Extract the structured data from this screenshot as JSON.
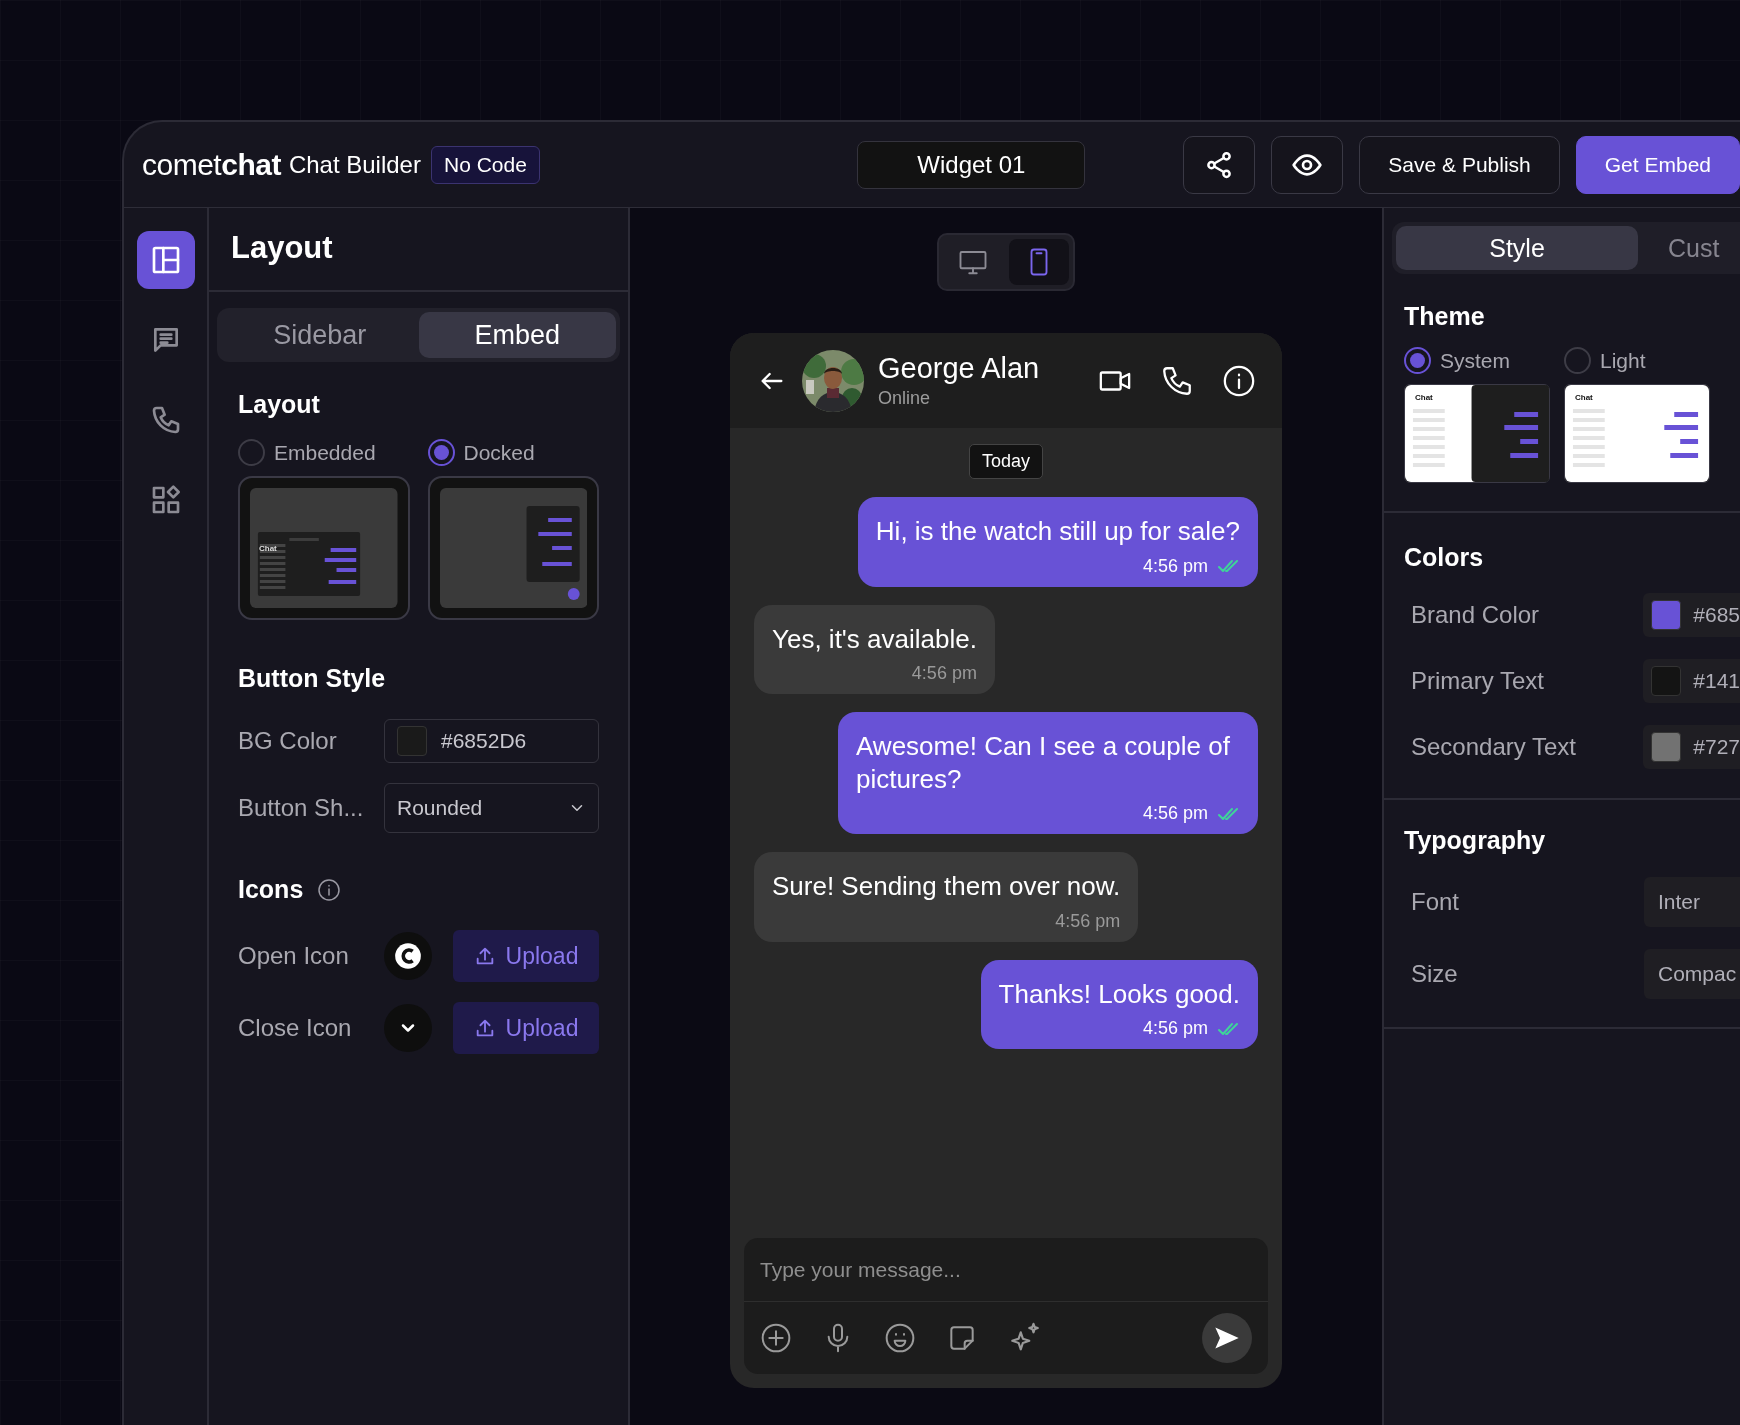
{
  "header": {
    "logo_light": "comet",
    "logo_bold": "chat",
    "product": "Chat Builder",
    "badge": "No Code",
    "widget_name": "Widget 01",
    "save_button": "Save & Publish",
    "embed_button": "Get Embed"
  },
  "rail": [
    {
      "kind": "layout",
      "selected": true
    },
    {
      "kind": "chat",
      "selected": false
    },
    {
      "kind": "call",
      "selected": false
    },
    {
      "kind": "widgets",
      "selected": false
    }
  ],
  "left_panel": {
    "title": "Layout",
    "tabs": [
      {
        "label": "Sidebar",
        "selected": false
      },
      {
        "label": "Embed",
        "selected": true
      }
    ],
    "layout_section": {
      "title": "Layout",
      "options": [
        {
          "label": "Embedded",
          "selected": false,
          "kind": "embedded",
          "preview_label": "Chat"
        },
        {
          "label": "Docked",
          "selected": true,
          "kind": "docked"
        }
      ]
    },
    "button_style": {
      "title": "Button Style",
      "bg_color": {
        "label": "BG Color",
        "value": "#6852D6",
        "color": "#1a1a1a"
      },
      "shape": {
        "label": "Button Sh...",
        "value": "Rounded"
      }
    },
    "icons": {
      "title": "Icons",
      "rows": [
        {
          "label": "Open Icon",
          "kind": "logo",
          "button": "Upload"
        },
        {
          "label": "Close Icon",
          "kind": "chevron",
          "button": "Upload"
        }
      ]
    }
  },
  "device_toggle": [
    {
      "kind": "desktop",
      "selected": false
    },
    {
      "kind": "mobile",
      "selected": true
    }
  ],
  "chat": {
    "name": "George Alan",
    "status": "Online",
    "date_chip": "Today",
    "messages": [
      {
        "text": "Hi, is the watch still up for sale?",
        "time": "4:56 pm",
        "outgoing": true,
        "read": true
      },
      {
        "text": "Yes, it's available.",
        "time": "4:56 pm",
        "outgoing": false,
        "read": false
      },
      {
        "text": "Awesome! Can I see a couple of pictures?",
        "time": "4:56 pm",
        "outgoing": true,
        "read": true
      },
      {
        "text": "Sure! Sending them over now.",
        "time": "4:56 pm",
        "outgoing": false,
        "read": false
      },
      {
        "text": "Thanks! Looks good.",
        "time": "4:56 pm",
        "outgoing": true,
        "read": true
      }
    ],
    "composer": {
      "placeholder": "Type your message..."
    }
  },
  "right_panel": {
    "tabs": [
      {
        "label": "Style",
        "selected": true
      },
      {
        "label": "Cust",
        "selected": false
      }
    ],
    "theme": {
      "title": "Theme",
      "options": [
        {
          "label": "System",
          "selected": true,
          "kind": "system",
          "preview_label": "Chat"
        },
        {
          "label": "Light",
          "selected": false,
          "kind": "light",
          "preview_label": "Chat"
        }
      ]
    },
    "colors": {
      "title": "Colors",
      "rows": [
        {
          "label": "Brand Color",
          "value": "#685",
          "color": "#6852d6"
        },
        {
          "label": "Primary Text",
          "value": "#141",
          "color": "#141414"
        },
        {
          "label": "Secondary Text",
          "value": "#727",
          "color": "#727272"
        }
      ]
    },
    "typography": {
      "title": "Typography",
      "rows": [
        {
          "label": "Font",
          "value": "Inter"
        },
        {
          "label": "Size",
          "value": "Compac"
        }
      ]
    }
  }
}
